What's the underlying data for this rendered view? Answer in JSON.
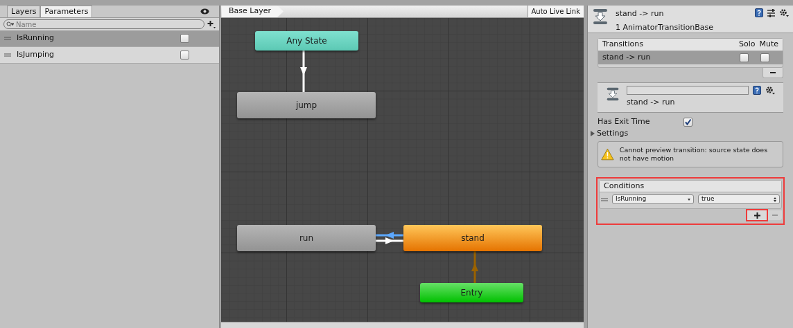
{
  "parameters_panel": {
    "tabs": [
      {
        "label": "Layers",
        "selected": false
      },
      {
        "label": "Parameters",
        "selected": true
      }
    ],
    "search": {
      "placeholder": "Name"
    },
    "parameters": [
      {
        "name": "IsRunning",
        "checked": false,
        "selected": true
      },
      {
        "name": "IsJumping",
        "checked": false,
        "selected": false
      }
    ]
  },
  "graph": {
    "breadcrumb": "Base Layer",
    "live_link_button": "Auto Live Link",
    "nodes": [
      {
        "label": "Any State",
        "kind": "any"
      },
      {
        "label": "jump",
        "kind": "state"
      },
      {
        "label": "run",
        "kind": "state"
      },
      {
        "label": "stand",
        "kind": "default"
      },
      {
        "label": "Entry",
        "kind": "entry"
      }
    ],
    "transitions": [
      {
        "kind": "normal",
        "selected": false
      },
      {
        "kind": "normal",
        "selected": true
      },
      {
        "kind": "normal",
        "selected": false
      },
      {
        "kind": "entry",
        "selected": false
      }
    ]
  },
  "inspector": {
    "title": "stand -> run",
    "subtitle": "1 AnimatorTransitionBase",
    "transitions": {
      "header": "Transitions",
      "solo_header": "Solo",
      "mute_header": "Mute",
      "rows": [
        {
          "name": "stand -> run",
          "solo": false,
          "mute": false,
          "selected": true
        }
      ]
    },
    "transition_name": "stand -> run",
    "has_exit_time": {
      "label": "Has Exit Time",
      "checked": true
    },
    "settings": {
      "label": "Settings",
      "expanded": false
    },
    "warning": "Cannot preview transition: source state does not have motion",
    "conditions": {
      "header": "Conditions",
      "highlighted": true,
      "rows": [
        {
          "parameter": "IsRunning",
          "value": "true"
        }
      ],
      "add_highlighted": true
    }
  }
}
